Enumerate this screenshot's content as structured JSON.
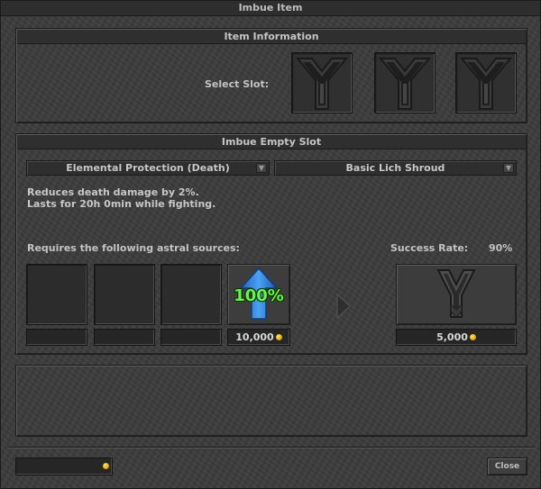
{
  "window": {
    "title": "Imbue Item"
  },
  "item_info": {
    "header": "Item Information",
    "select_slot_label": "Select Slot:",
    "slots": [
      "slot-1",
      "slot-2",
      "slot-3"
    ]
  },
  "imbue": {
    "header": "Imbue Empty Slot",
    "type_select": "Elemental Protection (Death)",
    "tier_select": "Basic Lich Shroud",
    "description_line1": "Reduces death damage by 2%.",
    "description_line2": "Lasts for 20h 0min while fighting.",
    "requires_label": "Requires the following astral sources:",
    "success_label": "Success Rate:",
    "success_value": "90%",
    "protection_gem_text": "100%",
    "protection_cost": "10,000",
    "imbue_cost": "5,000"
  },
  "footer": {
    "gold_balance": "",
    "close_label": "Close"
  },
  "colors": {
    "gold": "#e9a800",
    "gem_text": "#6cf04a",
    "arrow_blue": "#2f7fdc"
  },
  "icons": {
    "slot": "imbuement-slot-icon",
    "protection": "protection-arrow-icon",
    "next": "triangle-right-icon",
    "result": "imbue-rune-icon",
    "coin": "gold-coin-icon"
  }
}
